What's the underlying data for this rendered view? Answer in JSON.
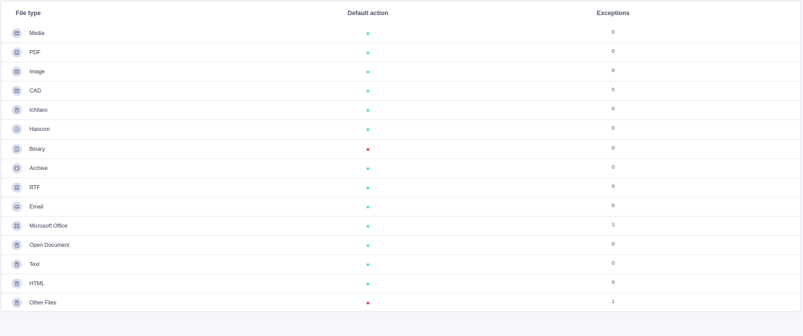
{
  "colors": {
    "allow": "#4eeab4",
    "block": "#f0434f",
    "icon_bg": "#dbe0ee",
    "icon_fg": "#8c95b3"
  },
  "table": {
    "headers": {
      "file_type": "File type",
      "default_action": "Default action",
      "exceptions": "Exceptions"
    },
    "rows": [
      {
        "name": "Media",
        "icon": "media-icon",
        "action": "allow",
        "exceptions": "0"
      },
      {
        "name": "PDF",
        "icon": "pdf-icon",
        "action": "allow",
        "exceptions": "0"
      },
      {
        "name": "Image",
        "icon": "image-icon",
        "action": "allow",
        "exceptions": "0"
      },
      {
        "name": "CAD",
        "icon": "cad-icon",
        "action": "allow",
        "exceptions": "0"
      },
      {
        "name": "Ichitaro",
        "icon": "document-icon",
        "action": "allow",
        "exceptions": "0"
      },
      {
        "name": "Hancom",
        "icon": "hancom-icon",
        "action": "allow",
        "exceptions": "0"
      },
      {
        "name": "Binary",
        "icon": "binary-icon",
        "action": "block",
        "exceptions": "0"
      },
      {
        "name": "Archive",
        "icon": "archive-icon",
        "action": "allow",
        "exceptions": "0"
      },
      {
        "name": "RTF",
        "icon": "rtf-icon",
        "action": "allow",
        "exceptions": "0"
      },
      {
        "name": "Email",
        "icon": "email-icon",
        "action": "allow",
        "exceptions": "0"
      },
      {
        "name": "Microsoft Office",
        "icon": "office-icon",
        "action": "allow",
        "exceptions": "1"
      },
      {
        "name": "Open Document",
        "icon": "document-icon",
        "action": "allow",
        "exceptions": "0"
      },
      {
        "name": "Text",
        "icon": "document-icon",
        "action": "allow",
        "exceptions": "0"
      },
      {
        "name": "HTML",
        "icon": "document-icon",
        "action": "allow",
        "exceptions": "0"
      },
      {
        "name": "Other Files",
        "icon": "document-icon",
        "action": "block",
        "exceptions": "1"
      }
    ]
  }
}
